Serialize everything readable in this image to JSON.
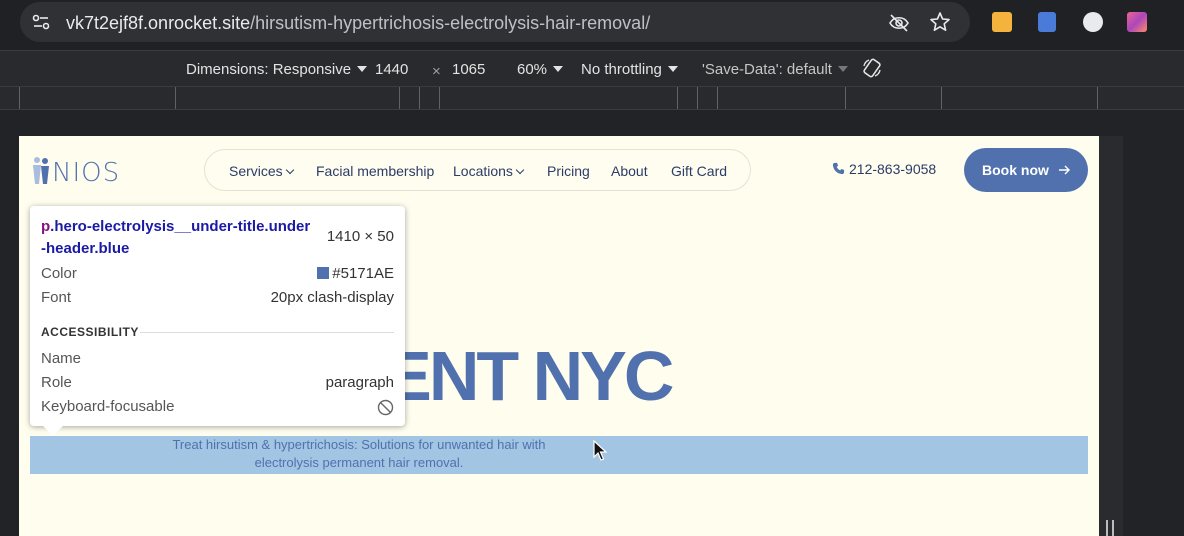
{
  "browser": {
    "url_host": "vk7t2ejf8f.onrocket.site",
    "url_path": "/hirsutism-hypertrichosis-electrolysis-hair-removal/"
  },
  "devtools_bar": {
    "dimensions_label": "Dimensions: Responsive",
    "width": "1440",
    "times": "×",
    "height": "1065",
    "zoom": "60%",
    "throttling": "No throttling",
    "save_data": "'Save-Data': default"
  },
  "site": {
    "logo_text": "NIOS",
    "nav": [
      "Services",
      "Facial membership",
      "Locations",
      "Pricing",
      "About",
      "Gift Card"
    ],
    "phone": "212-863-9058",
    "book_button": "Book now",
    "hero_title": "M TREATMENT NYC",
    "under_title": "Treat hirsutism & hypertrichosis: Solutions for unwanted hair with electrolysis permanent hair removal.",
    "brand_color": "#5171AE"
  },
  "inspect_tooltip": {
    "tag": "p",
    "selector": ".hero-electrolysis__under-title.under-header.blue",
    "size": "1410 × 50",
    "color_label": "Color",
    "color_value": "#5171AE",
    "font_label": "Font",
    "font_value": "20px clash-display",
    "section": "ACCESSIBILITY",
    "name_label": "Name",
    "role_label": "Role",
    "role_value": "paragraph",
    "focusable_label": "Keyboard-focusable"
  }
}
